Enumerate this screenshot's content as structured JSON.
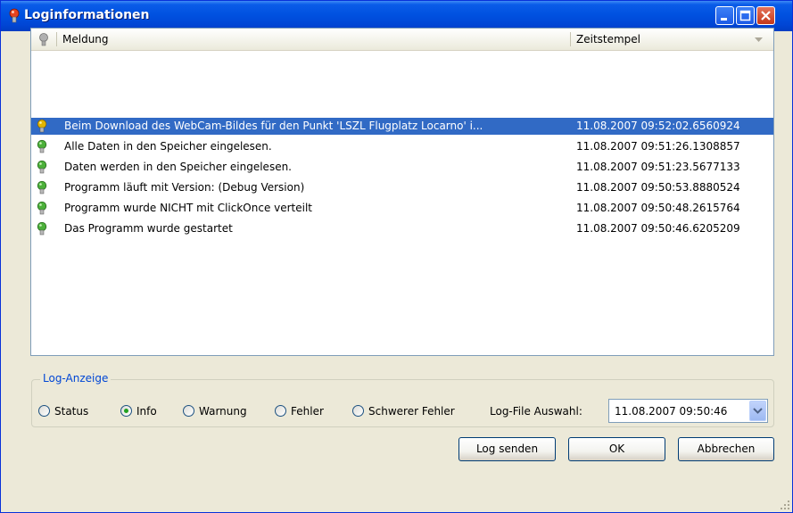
{
  "window": {
    "title": "Loginformationen"
  },
  "colors": {
    "title_bar": "#0054E3",
    "selection": "#316AC5",
    "group_title": "#0046D5",
    "icon_green": "#4CB03A",
    "icon_yellow": "#E2B400"
  },
  "log_list": {
    "columns": [
      {
        "label": "",
        "icon": "status-icon"
      },
      {
        "label": "Meldung"
      },
      {
        "label": "Zeitstempel",
        "sort_icon": "sort-arrow-icon"
      }
    ],
    "rows": [
      {
        "icon": "yellow-bulb-icon",
        "message": "Beim Download des WebCam-Bildes für den Punkt 'LSZL Flugplatz Locarno' i...",
        "timestamp": "11.08.2007 09:52:02.6560924",
        "selected": true
      },
      {
        "icon": "green-bulb-icon",
        "message": "Alle Daten in den Speicher eingelesen.",
        "timestamp": "11.08.2007 09:51:26.1308857",
        "selected": false
      },
      {
        "icon": "green-bulb-icon",
        "message": "Daten werden in den Speicher eingelesen.",
        "timestamp": "11.08.2007 09:51:23.5677133",
        "selected": false
      },
      {
        "icon": "green-bulb-icon",
        "message": "Programm läuft mit Version: (Debug Version)",
        "timestamp": "11.08.2007 09:50:53.8880524",
        "selected": false
      },
      {
        "icon": "green-bulb-icon",
        "message": "Programm wurde NICHT mit ClickOnce verteilt",
        "timestamp": "11.08.2007 09:50:48.2615764",
        "selected": false
      },
      {
        "icon": "green-bulb-icon",
        "message": "Das Programm wurde gestartet",
        "timestamp": "11.08.2007 09:50:46.6205209",
        "selected": false
      }
    ]
  },
  "log_display": {
    "title": "Log-Anzeige",
    "options": [
      {
        "label": "Status",
        "checked": false
      },
      {
        "label": "Info",
        "checked": true
      },
      {
        "label": "Warnung",
        "checked": false
      },
      {
        "label": "Fehler",
        "checked": false
      },
      {
        "label": "Schwerer Fehler",
        "checked": false
      }
    ],
    "log_file_label": "Log-File Auswahl:",
    "log_file_value": "11.08.2007 09:50:46"
  },
  "buttons": {
    "send": "Log senden",
    "ok": "OK",
    "cancel": "Abbrechen"
  }
}
